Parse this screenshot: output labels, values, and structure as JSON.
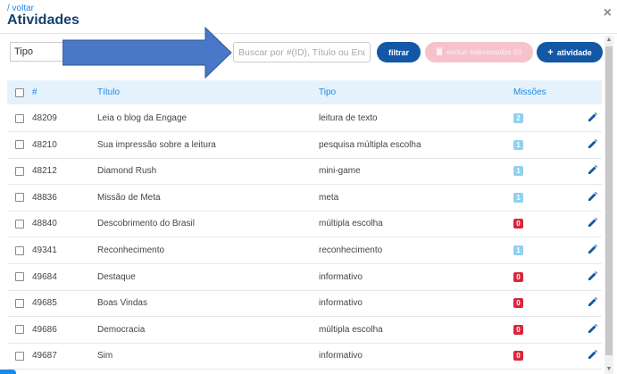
{
  "header": {
    "back_label": "/ voltar",
    "title": "Atividades",
    "close_glyph": "×"
  },
  "filters": {
    "type_select_value": "Tipo",
    "search_placeholder": "Buscar por #(ID), Título ou Enu",
    "filter_label": "filtrar",
    "delete_selected_label": "excluir selecionados (0)",
    "add_activity_label": "atividade",
    "add_plus": "+"
  },
  "table": {
    "columns": {
      "id": "#",
      "title": "Título",
      "type": "Tipo",
      "missions": "Missões"
    },
    "rows": [
      {
        "id": "48209",
        "title": "Leia o blog da Engage",
        "type": "leitura de texto",
        "missions": "2",
        "status": "light"
      },
      {
        "id": "48210",
        "title": "Sua impressão sobre a leitura",
        "type": "pesquisa múltipla escolha",
        "missions": "1",
        "status": "light"
      },
      {
        "id": "48212",
        "title": "Diamond Rush",
        "type": "mini-game",
        "missions": "1",
        "status": "light"
      },
      {
        "id": "48836",
        "title": "Missão de Meta",
        "type": "meta",
        "missions": "1",
        "status": "light"
      },
      {
        "id": "48840",
        "title": "Descobrimento do Brasil",
        "type": "múltipla escolha",
        "missions": "0",
        "status": "red"
      },
      {
        "id": "49341",
        "title": "Reconhecimento",
        "type": "reconhecimento",
        "missions": "1",
        "status": "light"
      },
      {
        "id": "49684",
        "title": "Destaque",
        "type": "informativo",
        "missions": "0",
        "status": "red"
      },
      {
        "id": "49685",
        "title": "Boas Vindas",
        "type": "informativo",
        "missions": "0",
        "status": "red"
      },
      {
        "id": "49686",
        "title": "Democracia",
        "type": "múltipla escolha",
        "missions": "0",
        "status": "red"
      },
      {
        "id": "49687",
        "title": "Sim",
        "type": "informativo",
        "missions": "0",
        "status": "red"
      }
    ]
  },
  "icons": {
    "edit": "pencil-icon",
    "delete": "trash-icon",
    "close": "close-icon",
    "annotation": "arrow-icon"
  },
  "colors": {
    "primary": "#1357a6",
    "accent": "#1e88e5",
    "badge_light": "#8fd0f2",
    "badge_red": "#d9263c",
    "arrow": "#4a78c8"
  }
}
